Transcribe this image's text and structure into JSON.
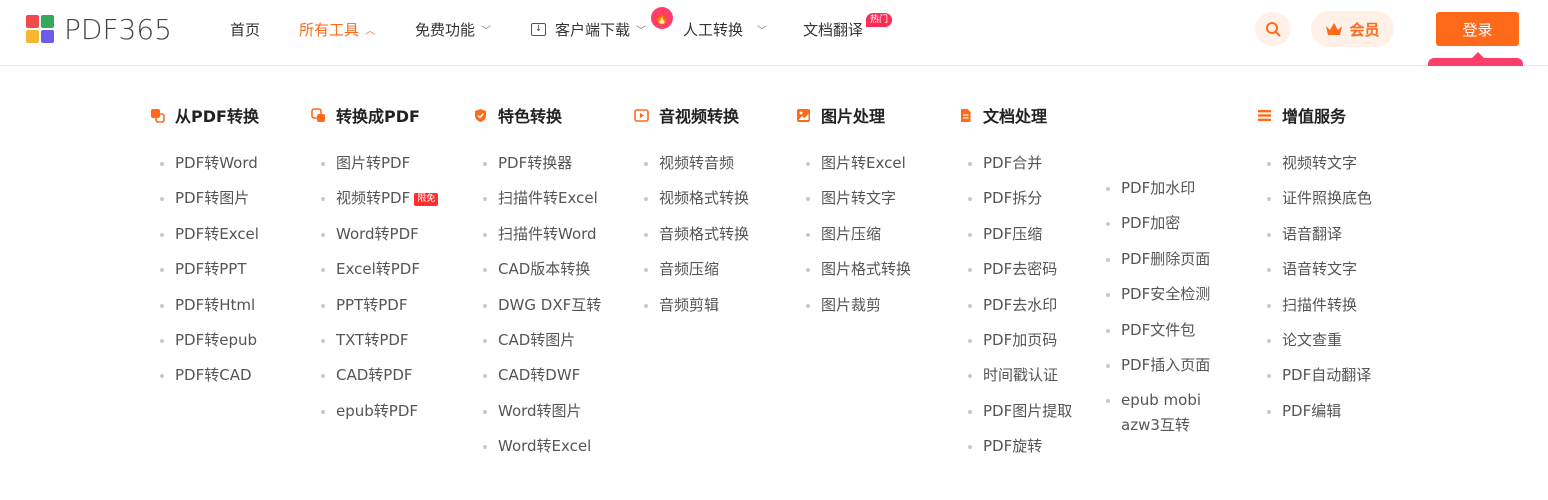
{
  "brand": {
    "name": "PDF365",
    "logo_colors": [
      "#f24a4a",
      "#37a85c",
      "#f7b731",
      "#6c5ce7"
    ]
  },
  "nav": {
    "home": "首页",
    "all_tools": "所有工具",
    "free": "免费功能",
    "download": "客户端下载",
    "manual": "人工转换",
    "translate": "文档翻译",
    "hot_badge": "热门"
  },
  "header": {
    "vip_label": "会员",
    "login_label": "登录",
    "accent_color": "#ff6a1a"
  },
  "columns": [
    {
      "title": "从PDF转换",
      "items": [
        "PDF转Word",
        "PDF转图片",
        "PDF转Excel",
        "PDF转PPT",
        "PDF转Html",
        "PDF转epub",
        "PDF转CAD"
      ]
    },
    {
      "title": "转换成PDF",
      "items": [
        "图片转PDF",
        "视频转PDF",
        "Word转PDF",
        "Excel转PDF",
        "PPT转PDF",
        "TXT转PDF",
        "CAD转PDF",
        "epub转PDF"
      ],
      "badge": "限免"
    },
    {
      "title": "特色转换",
      "items": [
        "PDF转换器",
        "扫描件转Excel",
        "扫描件转Word",
        "CAD版本转换",
        "DWG DXF互转",
        "CAD转图片",
        "CAD转DWF",
        "Word转图片",
        "Word转Excel"
      ]
    },
    {
      "title": "音视频转换",
      "items": [
        "视频转音频",
        "视频格式转换",
        "音频格式转换",
        "音频压缩",
        "音频剪辑"
      ]
    },
    {
      "title": "图片处理",
      "items": [
        "图片转Excel",
        "图片转文字",
        "图片压缩",
        "图片格式转换",
        "图片裁剪"
      ]
    },
    {
      "title": "文档处理",
      "items": [
        "PDF合并",
        "PDF拆分",
        "PDF压缩",
        "PDF去密码",
        "PDF去水印",
        "PDF加页码",
        "时间戳认证",
        "PDF图片提取",
        "PDF旋转"
      ],
      "items2": [
        "PDF加水印",
        "PDF加密",
        "PDF删除页面",
        "PDF安全检测",
        "PDF文件包",
        "PDF插入页面",
        "epub mobi azw3互转"
      ]
    },
    {
      "title": "增值服务",
      "items": [
        "视频转文字",
        "证件照换底色",
        "语音翻译",
        "语音转文字",
        "扫描件转换",
        "论文查重",
        "PDF自动翻译",
        "PDF编辑"
      ]
    }
  ]
}
